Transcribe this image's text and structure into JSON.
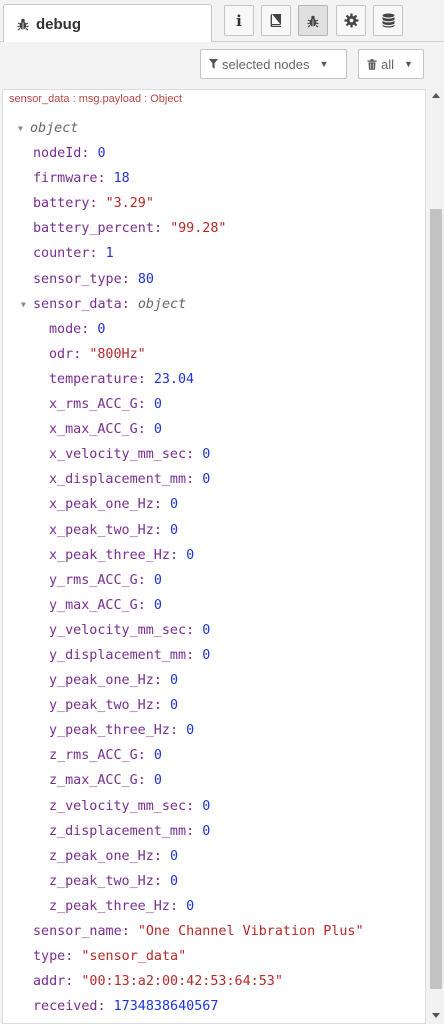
{
  "tab": {
    "label": "debug",
    "icon": "bug-icon"
  },
  "toolbar": {
    "buttons": [
      {
        "name": "info-button",
        "icon": "info-icon",
        "glyph": "i",
        "active": false
      },
      {
        "name": "help-button",
        "icon": "book-icon",
        "active": false
      },
      {
        "name": "debug-button",
        "icon": "bug-icon",
        "active": true
      },
      {
        "name": "config-button",
        "icon": "gear-icon",
        "active": false
      },
      {
        "name": "context-button",
        "icon": "database-icon",
        "active": false
      }
    ]
  },
  "filters": {
    "nodes_label": "selected nodes",
    "nodes_icon": "filter-icon",
    "clear_label": "all",
    "clear_icon": "trash-icon"
  },
  "message": {
    "meta": "sensor_data : msg.payload : Object",
    "root_type": "object",
    "fields": [
      {
        "key": "nodeId",
        "value": "0",
        "kind": "num"
      },
      {
        "key": "firmware",
        "value": "18",
        "kind": "num"
      },
      {
        "key": "battery",
        "value": "\"3.29\"",
        "kind": "str"
      },
      {
        "key": "battery_percent",
        "value": "\"99.28\"",
        "kind": "str"
      },
      {
        "key": "counter",
        "value": "1",
        "kind": "num"
      },
      {
        "key": "sensor_type",
        "value": "80",
        "kind": "num"
      }
    ],
    "nested_key": "sensor_data",
    "nested_type": "object",
    "nested_fields": [
      {
        "key": "mode",
        "value": "0",
        "kind": "num"
      },
      {
        "key": "odr",
        "value": "\"800Hz\"",
        "kind": "str"
      },
      {
        "key": "temperature",
        "value": "23.04",
        "kind": "num"
      },
      {
        "key": "x_rms_ACC_G",
        "value": "0",
        "kind": "num"
      },
      {
        "key": "x_max_ACC_G",
        "value": "0",
        "kind": "num"
      },
      {
        "key": "x_velocity_mm_sec",
        "value": "0",
        "kind": "num"
      },
      {
        "key": "x_displacement_mm",
        "value": "0",
        "kind": "num"
      },
      {
        "key": "x_peak_one_Hz",
        "value": "0",
        "kind": "num"
      },
      {
        "key": "x_peak_two_Hz",
        "value": "0",
        "kind": "num"
      },
      {
        "key": "x_peak_three_Hz",
        "value": "0",
        "kind": "num"
      },
      {
        "key": "y_rms_ACC_G",
        "value": "0",
        "kind": "num"
      },
      {
        "key": "y_max_ACC_G",
        "value": "0",
        "kind": "num"
      },
      {
        "key": "y_velocity_mm_sec",
        "value": "0",
        "kind": "num"
      },
      {
        "key": "y_displacement_mm",
        "value": "0",
        "kind": "num"
      },
      {
        "key": "y_peak_one_Hz",
        "value": "0",
        "kind": "num"
      },
      {
        "key": "y_peak_two_Hz",
        "value": "0",
        "kind": "num"
      },
      {
        "key": "y_peak_three_Hz",
        "value": "0",
        "kind": "num"
      },
      {
        "key": "z_rms_ACC_G",
        "value": "0",
        "kind": "num"
      },
      {
        "key": "z_max_ACC_G",
        "value": "0",
        "kind": "num"
      },
      {
        "key": "z_velocity_mm_sec",
        "value": "0",
        "kind": "num"
      },
      {
        "key": "z_displacement_mm",
        "value": "0",
        "kind": "num"
      },
      {
        "key": "z_peak_one_Hz",
        "value": "0",
        "kind": "num"
      },
      {
        "key": "z_peak_two_Hz",
        "value": "0",
        "kind": "num"
      },
      {
        "key": "z_peak_three_Hz",
        "value": "0",
        "kind": "num"
      }
    ],
    "trailing_fields": [
      {
        "key": "sensor_name",
        "value": "\"One Channel Vibration Plus\"",
        "kind": "str"
      },
      {
        "key": "type",
        "value": "\"sensor_data\"",
        "kind": "str"
      },
      {
        "key": "addr",
        "value": "\"00:13:a2:00:42:53:64:53\"",
        "kind": "str"
      },
      {
        "key": "received",
        "value": "1734838640567",
        "kind": "num"
      }
    ]
  },
  "colors": {
    "key": "#792e90",
    "number": "#2033d6",
    "string": "#b72828",
    "meta": "#b44444"
  }
}
